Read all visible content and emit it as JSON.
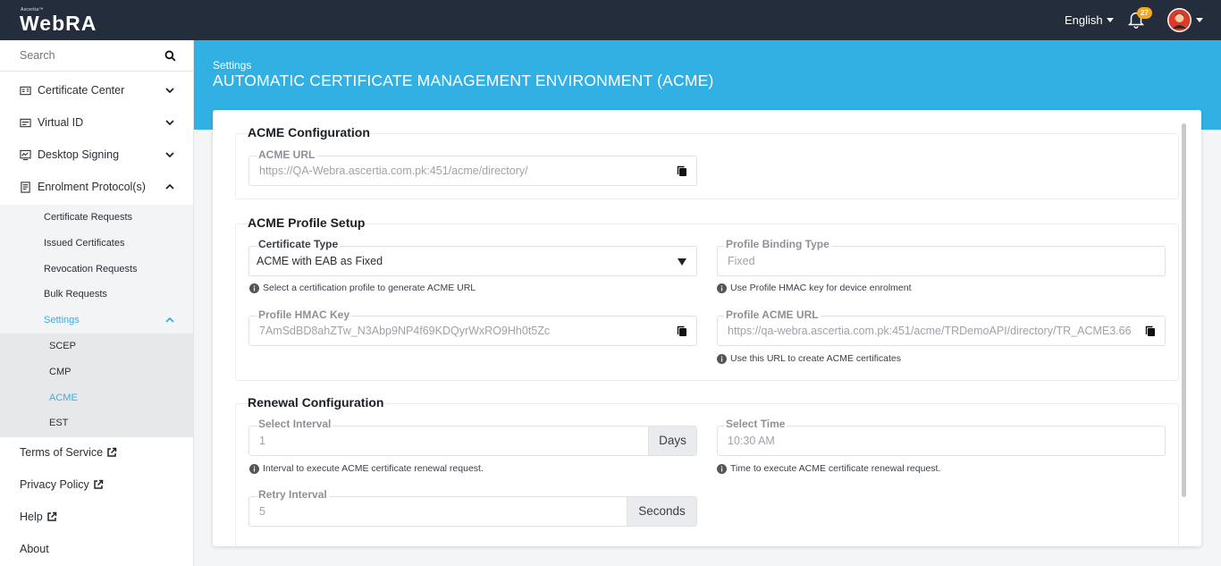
{
  "header": {
    "logo_small": "Ascertia™",
    "logo_main": "WebRA",
    "language": "English",
    "notification_count": "27"
  },
  "sidebar": {
    "search_placeholder": "Search",
    "items": [
      {
        "label": "Certificate Center"
      },
      {
        "label": "Virtual ID"
      },
      {
        "label": "Desktop Signing"
      },
      {
        "label": "Enrolment Protocol(s)"
      }
    ],
    "sub_items": [
      {
        "label": "Certificate Requests"
      },
      {
        "label": "Issued Certificates"
      },
      {
        "label": "Revocation Requests"
      },
      {
        "label": "Bulk Requests"
      },
      {
        "label": "Settings"
      }
    ],
    "subsub_items": [
      {
        "label": "SCEP"
      },
      {
        "label": "CMP"
      },
      {
        "label": "ACME"
      },
      {
        "label": "EST"
      }
    ],
    "footer": [
      {
        "label": "Terms of Service"
      },
      {
        "label": "Privacy Policy"
      },
      {
        "label": "Help"
      },
      {
        "label": "About"
      }
    ]
  },
  "banner": {
    "breadcrumb": "Settings",
    "title": "AUTOMATIC CERTIFICATE MANAGEMENT ENVIRONMENT (ACME)"
  },
  "acme_config": {
    "title": "ACME Configuration",
    "url_label": "ACME URL",
    "url_value": "https://QA-Webra.ascertia.com.pk:451/acme/directory/"
  },
  "profile_setup": {
    "title": "ACME Profile Setup",
    "cert_type_label": "Certificate Type",
    "cert_type_value": "ACME with EAB as Fixed",
    "cert_type_hint": "Select a certification profile to generate ACME URL",
    "binding_label": "Profile Binding Type",
    "binding_value": "Fixed",
    "binding_hint": "Use Profile HMAC key for device enrolment",
    "hmac_label": "Profile HMAC Key",
    "hmac_value": "7AmSdBD8ahZTw_N3Abp9NP4f69KDQyrWxRO9Hh0t5Zc",
    "profile_url_label": "Profile ACME URL",
    "profile_url_value": "https://qa-webra.ascertia.com.pk:451/acme/TRDemoAPI/directory/TR_ACME3.66",
    "profile_url_hint": "Use this URL to create ACME certificates"
  },
  "renewal": {
    "title": "Renewal Configuration",
    "interval_label": "Select Interval",
    "interval_value": "1",
    "interval_unit": "Days",
    "interval_hint": "Interval to execute ACME certificate renewal request.",
    "time_label": "Select Time",
    "time_value": "10:30 AM",
    "time_hint": "Time to execute ACME certificate renewal request.",
    "retry_label": "Retry Interval",
    "retry_value": "5",
    "retry_unit": "Seconds"
  },
  "colors": {
    "topbar": "#232d3c",
    "accent": "#31b1e3",
    "badge": "#f5a623"
  }
}
